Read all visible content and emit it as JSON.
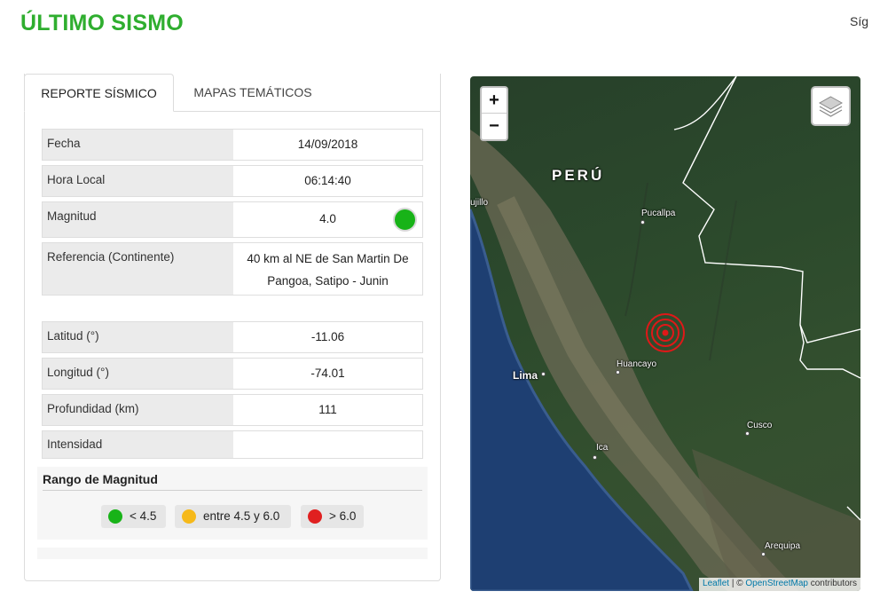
{
  "page": {
    "title": "ÚLTIMO SISMO",
    "follow": "Síg"
  },
  "tabs": [
    {
      "label": "REPORTE SÍSMICO",
      "active": true
    },
    {
      "label": "MAPAS TEMÁTICOS",
      "active": false
    }
  ],
  "report": {
    "fecha": {
      "label": "Fecha",
      "value": "14/09/2018"
    },
    "hora": {
      "label": "Hora Local",
      "value": "06:14:40"
    },
    "magnitud": {
      "label": "Magnitud",
      "value": "4.0",
      "indicator_color": "#18b318"
    },
    "referencia": {
      "label": "Referencia (Continente",
      "label_close": ")",
      "value_line1": "40 km al NE de San Martin De",
      "value_line2": "Pangoa, Satipo - Junin"
    },
    "latitud": {
      "label": "Latitud (°)",
      "value": "-11.06"
    },
    "longitud": {
      "label": "Longitud (°)",
      "value": "-74.01"
    },
    "profundidad": {
      "label": "Profundidad (km)",
      "value": "111"
    },
    "intensidad": {
      "label": "Intensidad",
      "value": ""
    }
  },
  "range": {
    "title": "Rango de Magnitud",
    "items": [
      {
        "label": "< 4.5",
        "color": "#18b318"
      },
      {
        "label": "entre 4.5 y 6.0",
        "color": "#f6b91a"
      },
      {
        "label": "> 6.0",
        "color": "#e02020"
      }
    ]
  },
  "map": {
    "zoom_in": "+",
    "zoom_out": "−",
    "labels": {
      "country": "PERÚ",
      "trujillo": "Trujillo",
      "pucallpa": "Pucallpa",
      "lima": "Lima",
      "huancayo": "Huancayo",
      "cusco": "Cusco",
      "ica": "Ica",
      "arequipa": "Arequipa"
    },
    "attribution": {
      "leaflet": "Leaflet",
      "sep": " | © ",
      "osm": "OpenStreetMap",
      "rest": " contributors"
    },
    "epicenter_color": "#e01818"
  }
}
